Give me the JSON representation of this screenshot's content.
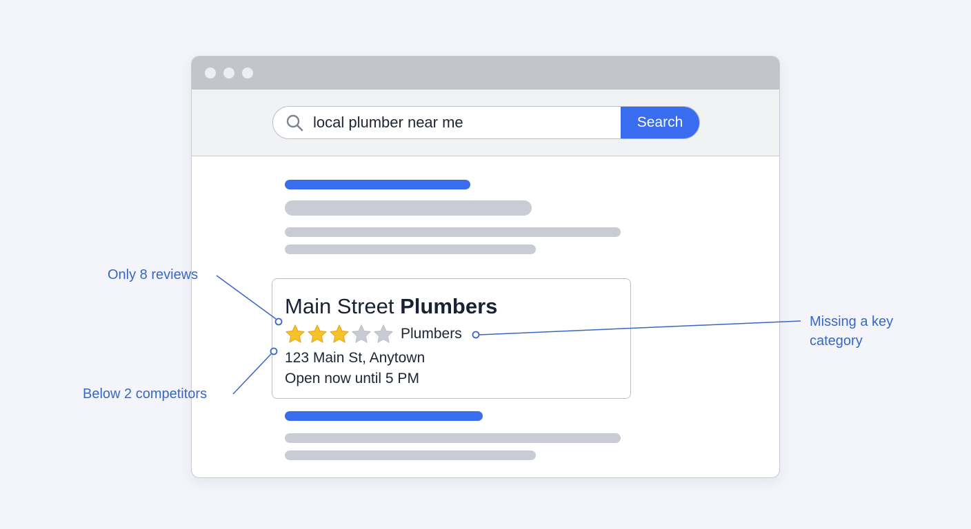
{
  "search": {
    "query": "local plumber near me",
    "button_label": "Search"
  },
  "result": {
    "name_regular": "Main Street ",
    "name_bold": "Plumbers",
    "rating_stars": 3,
    "rating_max": 5,
    "category": "Plumbers",
    "address": "123 Main St, Anytown",
    "hours": "Open now until 5 PM"
  },
  "annotations": {
    "reviews": "Only 8 reviews",
    "ranking": "Below 2 competitors",
    "category": "Missing a key category"
  },
  "colors": {
    "accent": "#3a6cf0",
    "annotation": "#3866c4",
    "star_filled": "#f6c12c",
    "star_empty": "#c9ccd4"
  },
  "icons": {
    "search": "search-icon",
    "star": "star-icon"
  }
}
